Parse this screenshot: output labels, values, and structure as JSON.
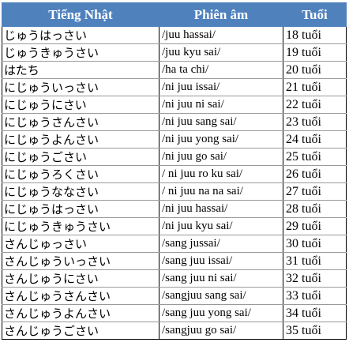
{
  "headers": [
    "Tiếng Nhật",
    "Phiên âm",
    "Tuổi"
  ],
  "rows": [
    {
      "jp": "じゅうはっさい",
      "romaji": "/juu hassai/",
      "age": "18 tuổi"
    },
    {
      "jp": "じゅうきゅうさい",
      "romaji": "/juu kyu sai/",
      "age": "19 tuổi"
    },
    {
      "jp": "はたち",
      "romaji": "/ha ta chi/",
      "age": "20 tuổi"
    },
    {
      "jp": "にじゅういっさい",
      "romaji": "/ni juu issai/",
      "age": "21 tuổi"
    },
    {
      "jp": "にじゅうにさい",
      "romaji": "/ni juu ni sai/",
      "age": "22 tuổi"
    },
    {
      "jp": "にじゅうさんさい",
      "romaji": "/ni juu sang sai/",
      "age": "23 tuổi"
    },
    {
      "jp": "にじゅうよんさい",
      "romaji": "/ni juu yong sai/",
      "age": "24 tuổi"
    },
    {
      "jp": "にじゅうごさい",
      "romaji": "/ni juu go sai/",
      "age": "25 tuổi"
    },
    {
      "jp": "にじゅうろくさい",
      "romaji": "/ ni juu ro ku sai/",
      "age": "26 tuổi"
    },
    {
      "jp": "にじゅうななさい",
      "romaji": "/ ni juu na na sai/",
      "age": "27 tuổi"
    },
    {
      "jp": "にじゅうはっさい",
      "romaji": "/ni juu hassai/",
      "age": "28 tuổi"
    },
    {
      "jp": "にじゅうきゅうさい",
      "romaji": "/ni juu kyu sai/",
      "age": "29 tuổi"
    },
    {
      "jp": "さんじゅっさい",
      "romaji": "/sang jussai/",
      "age": "30 tuổi"
    },
    {
      "jp": "さんじゅういっさい",
      "romaji": "/sang juu issai/",
      "age": "31 tuổi"
    },
    {
      "jp": "さんじゅうにさい",
      "romaji": " /sang juu ni sai/",
      "age": "32 tuổi"
    },
    {
      "jp": "さんじゅうさんさい",
      "romaji": "/sangjuu sang sai/",
      "age": "33 tuổi"
    },
    {
      "jp": "さんじゅうよんさい",
      "romaji": "/sang juu yong sai/",
      "age": "34 tuổi"
    },
    {
      "jp": "さんじゅうごさい",
      "romaji": "/sangjuu go sai/",
      "age": "35 tuổi"
    }
  ],
  "colors": {
    "header_bg": "#4f81bd",
    "header_text": "#ffffff"
  }
}
